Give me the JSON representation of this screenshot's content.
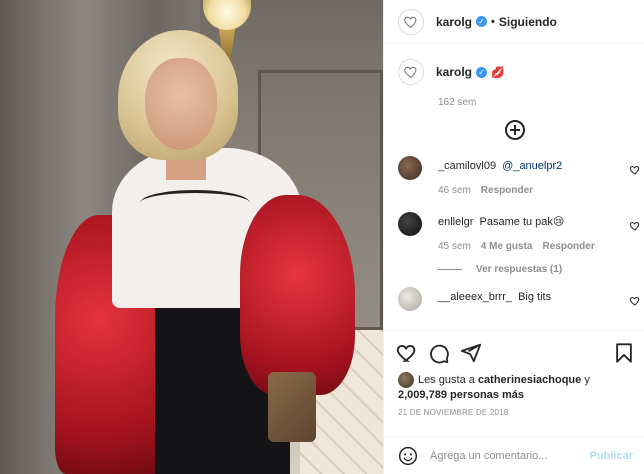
{
  "post": {
    "author": "karolg",
    "follow_status": "Siguiendo",
    "dot": "•",
    "verified_glyph": "✓",
    "caption_emoji": "💋",
    "caption_age": "162 sem"
  },
  "comments": [
    {
      "user": "_camilovl09",
      "text": "@_anuelpr2",
      "is_mention": true,
      "age": "46 sem",
      "likes": "",
      "reply_label": "Responder",
      "avatar_color": "#3a2a20"
    },
    {
      "user": "enllelgr",
      "text": "Pasame tu pak😢",
      "is_mention": false,
      "age": "45 sem",
      "likes": "4 Me gusta",
      "reply_label": "Responder",
      "avatar_color": "#141414"
    },
    {
      "user": "__aleeex_brrr_",
      "text": "Big tits",
      "is_mention": false,
      "age": "",
      "likes": "",
      "reply_label": "",
      "avatar_color": "#d9d6d1"
    }
  ],
  "view_replies": "Ver respuestas (1)",
  "likes": {
    "prefix": "Les gusta a",
    "user": "catherinesiachoque",
    "joiner": "y",
    "count": "2,009,789 personas más"
  },
  "date": "21 DE NOVIEMBRE DE 2018",
  "add_comment": {
    "placeholder": "Agrega un comentario...",
    "publish_label": "Publicar"
  },
  "icons": {
    "like": "heart-icon",
    "comment": "comment-icon",
    "share": "share-icon",
    "save": "bookmark-icon",
    "emoji": "emoji-icon",
    "more": "plus-circle-icon"
  },
  "colors": {
    "verified": "#3897f0",
    "publish_disabled": "#b2dffc",
    "meta_gray": "#8e8e8e"
  }
}
